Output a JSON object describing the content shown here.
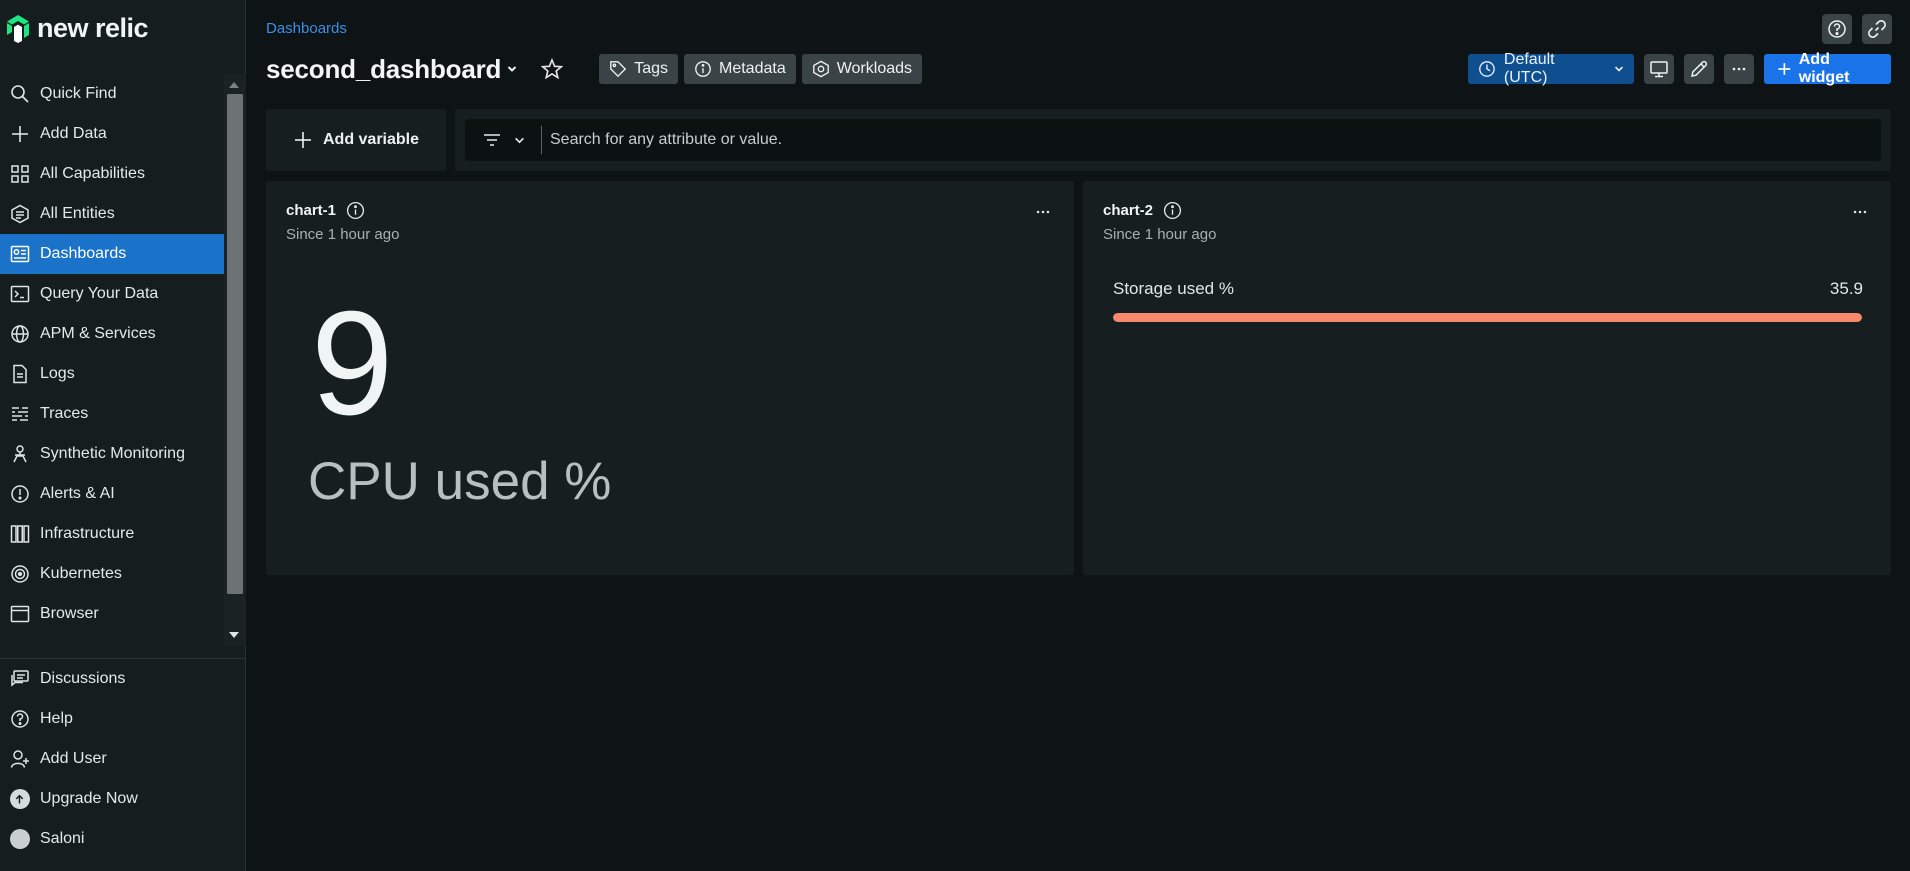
{
  "app": {
    "logo_text": "new relic"
  },
  "sidebar": {
    "items": [
      {
        "label": "Quick Find",
        "icon": "search-icon"
      },
      {
        "label": "Add Data",
        "icon": "plus-icon"
      },
      {
        "label": "All Capabilities",
        "icon": "grid-icon"
      },
      {
        "label": "All Entities",
        "icon": "entities-icon"
      },
      {
        "label": "Dashboards",
        "icon": "dashboard-icon",
        "active": true
      },
      {
        "label": "Query Your Data",
        "icon": "terminal-icon"
      },
      {
        "label": "APM & Services",
        "icon": "globe-icon"
      },
      {
        "label": "Logs",
        "icon": "document-icon"
      },
      {
        "label": "Traces",
        "icon": "traces-icon"
      },
      {
        "label": "Synthetic Monitoring",
        "icon": "robot-icon"
      },
      {
        "label": "Alerts & AI",
        "icon": "alert-icon"
      },
      {
        "label": "Infrastructure",
        "icon": "infrastructure-icon"
      },
      {
        "label": "Kubernetes",
        "icon": "kubernetes-icon"
      },
      {
        "label": "Browser",
        "icon": "browser-icon"
      }
    ],
    "bottom_items": [
      {
        "label": "Discussions",
        "icon": "discussions-icon"
      },
      {
        "label": "Help",
        "icon": "help-icon"
      },
      {
        "label": "Add User",
        "icon": "add-user-icon"
      },
      {
        "label": "Upgrade Now",
        "icon": "upgrade-icon"
      },
      {
        "label": "Saloni",
        "icon": "avatar-icon"
      }
    ]
  },
  "header": {
    "breadcrumb": "Dashboards",
    "title": "second_dashboard",
    "tags_label": "Tags",
    "metadata_label": "Metadata",
    "workloads_label": "Workloads",
    "timezone_label": "Default (UTC)",
    "add_widget_label": "Add widget"
  },
  "filter": {
    "add_variable_label": "Add variable",
    "search_placeholder": "Search for any attribute or value."
  },
  "widgets": {
    "chart1": {
      "title": "chart-1",
      "subtitle": "Since 1 hour ago",
      "value": "9",
      "label": "CPU used %"
    },
    "chart2": {
      "title": "chart-2",
      "subtitle": "Since 1 hour ago",
      "label": "Storage used %",
      "value": "35.9",
      "fill_percent": 100
    }
  },
  "colors": {
    "accent": "#1a73e8",
    "active_nav": "#1a73c8",
    "bar_fill": "#f4896b",
    "breadcrumb": "#3b8fe6"
  }
}
